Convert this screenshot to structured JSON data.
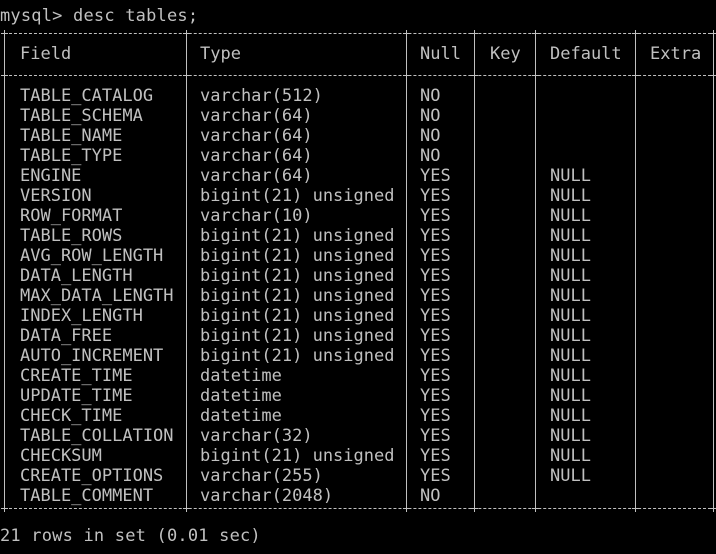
{
  "terminal": {
    "prompt": "mysql>",
    "command": "desc tables;",
    "summary": "21 rows in set (0.01 sec)"
  },
  "table": {
    "columns": [
      "Field",
      "Type",
      "Null",
      "Key",
      "Default",
      "Extra"
    ],
    "rows": [
      {
        "field": "TABLE_CATALOG",
        "type": "varchar(512)",
        "null": "NO",
        "key": "",
        "default": "",
        "extra": ""
      },
      {
        "field": "TABLE_SCHEMA",
        "type": "varchar(64)",
        "null": "NO",
        "key": "",
        "default": "",
        "extra": ""
      },
      {
        "field": "TABLE_NAME",
        "type": "varchar(64)",
        "null": "NO",
        "key": "",
        "default": "",
        "extra": ""
      },
      {
        "field": "TABLE_TYPE",
        "type": "varchar(64)",
        "null": "NO",
        "key": "",
        "default": "",
        "extra": ""
      },
      {
        "field": "ENGINE",
        "type": "varchar(64)",
        "null": "YES",
        "key": "",
        "default": "NULL",
        "extra": ""
      },
      {
        "field": "VERSION",
        "type": "bigint(21) unsigned",
        "null": "YES",
        "key": "",
        "default": "NULL",
        "extra": ""
      },
      {
        "field": "ROW_FORMAT",
        "type": "varchar(10)",
        "null": "YES",
        "key": "",
        "default": "NULL",
        "extra": ""
      },
      {
        "field": "TABLE_ROWS",
        "type": "bigint(21) unsigned",
        "null": "YES",
        "key": "",
        "default": "NULL",
        "extra": ""
      },
      {
        "field": "AVG_ROW_LENGTH",
        "type": "bigint(21) unsigned",
        "null": "YES",
        "key": "",
        "default": "NULL",
        "extra": ""
      },
      {
        "field": "DATA_LENGTH",
        "type": "bigint(21) unsigned",
        "null": "YES",
        "key": "",
        "default": "NULL",
        "extra": ""
      },
      {
        "field": "MAX_DATA_LENGTH",
        "type": "bigint(21) unsigned",
        "null": "YES",
        "key": "",
        "default": "NULL",
        "extra": ""
      },
      {
        "field": "INDEX_LENGTH",
        "type": "bigint(21) unsigned",
        "null": "YES",
        "key": "",
        "default": "NULL",
        "extra": ""
      },
      {
        "field": "DATA_FREE",
        "type": "bigint(21) unsigned",
        "null": "YES",
        "key": "",
        "default": "NULL",
        "extra": ""
      },
      {
        "field": "AUTO_INCREMENT",
        "type": "bigint(21) unsigned",
        "null": "YES",
        "key": "",
        "default": "NULL",
        "extra": ""
      },
      {
        "field": "CREATE_TIME",
        "type": "datetime",
        "null": "YES",
        "key": "",
        "default": "NULL",
        "extra": ""
      },
      {
        "field": "UPDATE_TIME",
        "type": "datetime",
        "null": "YES",
        "key": "",
        "default": "NULL",
        "extra": ""
      },
      {
        "field": "CHECK_TIME",
        "type": "datetime",
        "null": "YES",
        "key": "",
        "default": "NULL",
        "extra": ""
      },
      {
        "field": "TABLE_COLLATION",
        "type": "varchar(32)",
        "null": "YES",
        "key": "",
        "default": "NULL",
        "extra": ""
      },
      {
        "field": "CHECKSUM",
        "type": "bigint(21) unsigned",
        "null": "YES",
        "key": "",
        "default": "NULL",
        "extra": ""
      },
      {
        "field": "CREATE_OPTIONS",
        "type": "varchar(255)",
        "null": "YES",
        "key": "",
        "default": "NULL",
        "extra": ""
      },
      {
        "field": "TABLE_COMMENT",
        "type": "varchar(2048)",
        "null": "NO",
        "key": "",
        "default": "",
        "extra": ""
      }
    ]
  },
  "colors": {
    "background": "#000000",
    "text": "#c0c0c0"
  }
}
